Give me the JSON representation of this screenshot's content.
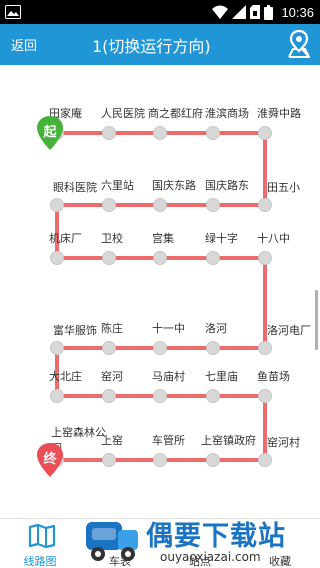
{
  "status_bar": {
    "time": "10:36"
  },
  "header": {
    "back_label": "返回",
    "title": "1(切换运行方向)"
  },
  "route": {
    "start_badge": "起",
    "end_badge": "终",
    "stations": [
      "田家庵",
      "人民医院",
      "商之都红府",
      "淮滨商场",
      "淮舜中路",
      "田五小",
      "国庆路东",
      "国庆东路",
      "六里站",
      "眼科医院",
      "机床厂",
      "卫校",
      "宫集",
      "绿十字",
      "十八中",
      "洛河电厂",
      "洛河",
      "十一中",
      "陈庄",
      "富华服饰",
      "大北庄",
      "窑河",
      "马庙村",
      "七里庙",
      "鱼苗场",
      "窑河村",
      "上窑镇政府",
      "车管所",
      "上窑",
      "上窑森林公园"
    ]
  },
  "tabbar": {
    "tabs": [
      {
        "label": "线路图",
        "icon": "book-map-icon"
      },
      {
        "label": "车表",
        "icon": "bus-icon"
      },
      {
        "label": "站点",
        "icon": "station-icon"
      },
      {
        "label": "收藏",
        "icon": "star-icon"
      }
    ]
  },
  "watermark": {
    "title": "偶要下载站",
    "url": "ouyaoxiazai.com"
  }
}
